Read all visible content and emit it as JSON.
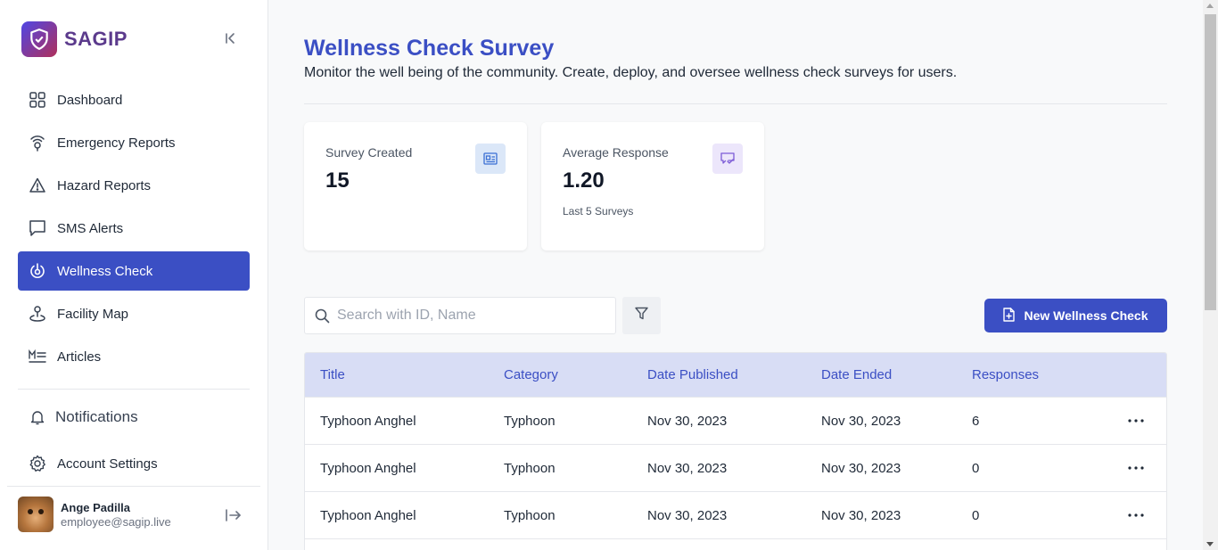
{
  "brand": {
    "name": "SAGIP",
    "logo_icon": "shield-logo-icon",
    "collapse_icon": "collapse-sidebar-icon"
  },
  "nav": [
    {
      "label": "Dashboard",
      "icon": "dashboard-grid-icon"
    },
    {
      "label": "Emergency Reports",
      "icon": "broadcast-location-icon"
    },
    {
      "label": "Hazard Reports",
      "icon": "warning-triangle-icon"
    },
    {
      "label": "SMS Alerts",
      "icon": "message-square-icon"
    },
    {
      "label": "Wellness Check",
      "icon": "power-target-icon",
      "active": true
    },
    {
      "label": "Facility Map",
      "icon": "map-pin-icon"
    },
    {
      "label": "Articles",
      "icon": "markdown-icon"
    }
  ],
  "notifications_label": "Notifications",
  "account_settings_label": "Account Settings",
  "user": {
    "name": "Ange Padilla",
    "email": "employee@sagip.live"
  },
  "header": {
    "title": "Wellness Check Survey",
    "subtitle": "Monitor the well being of the community. Create, deploy, and oversee wellness check surveys for users."
  },
  "cards": [
    {
      "label": "Survey Created",
      "value": "15",
      "note": "",
      "icon": "survey-id-card-icon",
      "icon_bg": "#dbe7f8",
      "icon_color": "#3b6fd4"
    },
    {
      "label": "Average Response",
      "value": "1.20",
      "note": "Last 5 Surveys",
      "icon": "message-check-icon",
      "icon_bg": "#ece6fb",
      "icon_color": "#7c5bd6"
    }
  ],
  "search": {
    "placeholder": "Search with ID, Name",
    "value": ""
  },
  "new_button_label": "New Wellness Check",
  "table": {
    "columns": [
      "Title",
      "Category",
      "Date Published",
      "Date Ended",
      "Responses"
    ],
    "rows": [
      {
        "title": "Typhoon Anghel",
        "category": "Typhoon",
        "published": "Nov 30, 2023",
        "ended": "Nov 30, 2023",
        "responses": "6"
      },
      {
        "title": "Typhoon Anghel",
        "category": "Typhoon",
        "published": "Nov 30, 2023",
        "ended": "Nov 30, 2023",
        "responses": "0"
      },
      {
        "title": "Typhoon Anghel",
        "category": "Typhoon",
        "published": "Nov 30, 2023",
        "ended": "Nov 30, 2023",
        "responses": "0"
      }
    ]
  },
  "colors": {
    "accent": "#3b4fc4",
    "table_header_bg": "#d8ddf5"
  }
}
